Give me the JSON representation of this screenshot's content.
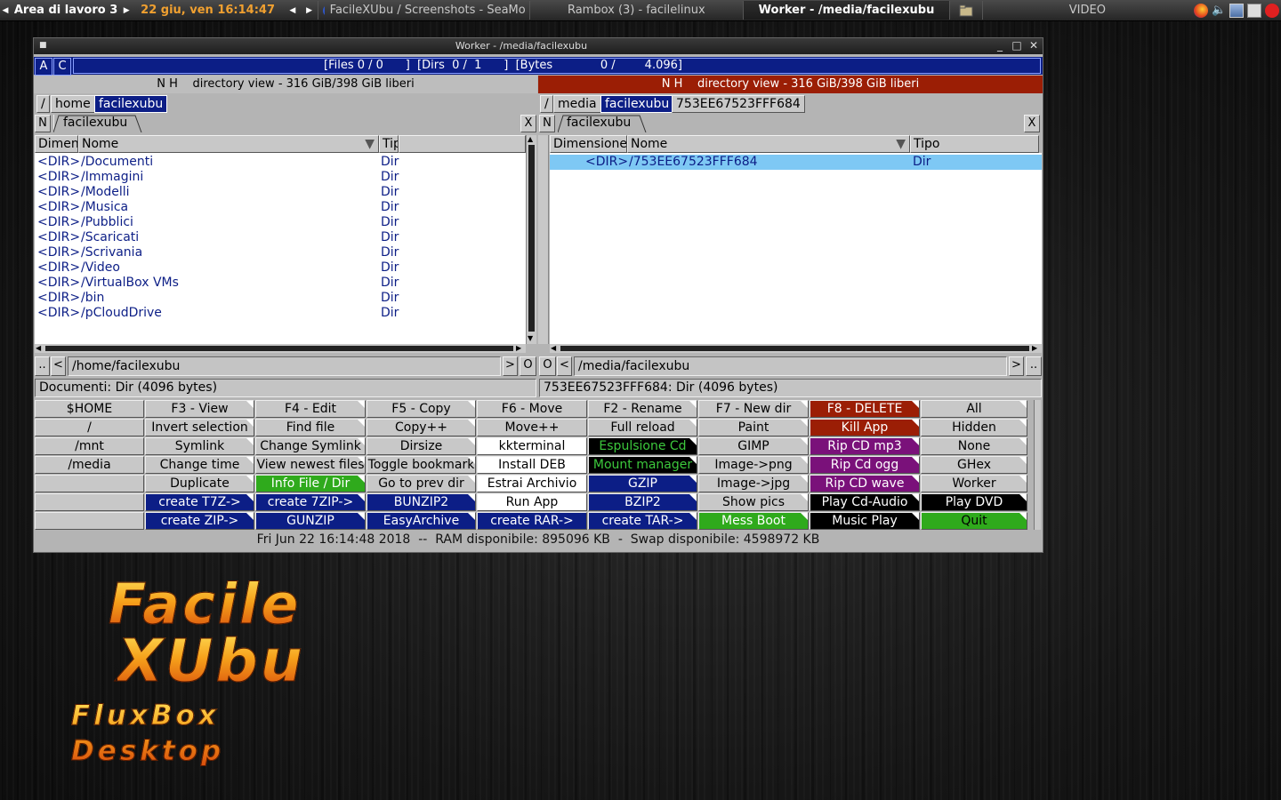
{
  "taskbar": {
    "workspace": "Area di lavoro 3",
    "datetime": "22 giu, ven 16:14:47",
    "tasks": [
      {
        "label": "FacileXUbu / Screenshots - SeaMo",
        "active": false
      },
      {
        "label": "Rambox (3) - facilelinux",
        "active": false
      },
      {
        "label": "Worker - /media/facilexubu",
        "active": true
      },
      {
        "label": "",
        "active": false
      },
      {
        "label": "VIDEO",
        "active": false
      }
    ]
  },
  "window": {
    "title": "Worker - /media/facilexubu",
    "status_a": "A",
    "status_c": "C",
    "status_text": "[Files 0 / 0      ]  [Dirs  0 /  1      ]  [Bytes             0 /        4.096]",
    "left": {
      "header": "N H    directory view - 316 GiB/398 GiB liberi",
      "crumbs": [
        "/",
        "home",
        "facilexubu"
      ],
      "tab_new": "N",
      "tab_label": "facilexubu",
      "tab_close": "X",
      "columns": [
        "Dimen",
        "Nome",
        "Tip"
      ],
      "rows": [
        {
          "size": "<DIR>",
          "name": "/Documenti",
          "type": "Dir"
        },
        {
          "size": "<DIR>",
          "name": "/Immagini",
          "type": "Dir"
        },
        {
          "size": "<DIR>",
          "name": "/Modelli",
          "type": "Dir"
        },
        {
          "size": "<DIR>",
          "name": "/Musica",
          "type": "Dir"
        },
        {
          "size": "<DIR>",
          "name": "/Pubblici",
          "type": "Dir"
        },
        {
          "size": "<DIR>",
          "name": "/Scaricati",
          "type": "Dir"
        },
        {
          "size": "<DIR>",
          "name": "/Scrivania",
          "type": "Dir"
        },
        {
          "size": "<DIR>",
          "name": "/Video",
          "type": "Dir"
        },
        {
          "size": "<DIR>",
          "name": "/VirtualBox VMs",
          "type": "Dir"
        },
        {
          "size": "<DIR>",
          "name": "/bin",
          "type": "Dir"
        },
        {
          "size": "<DIR>",
          "name": "/pCloudDrive",
          "type": "Dir"
        }
      ],
      "path": "/home/facilexubu",
      "info": "Documenti: Dir (4096 bytes)"
    },
    "right": {
      "header": "N H    directory view - 316 GiB/398 GiB liberi",
      "crumbs": [
        "/",
        "media",
        "facilexubu",
        "753EE67523FFF684"
      ],
      "tab_new": "N",
      "tab_label": "facilexubu",
      "tab_close": "X",
      "columns": [
        "Dimensione",
        "Nome",
        "Tipo"
      ],
      "rows": [
        {
          "size": "<DIR>",
          "name": "/753EE67523FFF684",
          "type": "Dir"
        }
      ],
      "path": "/media/facilexubu",
      "info": "753EE67523FFF684: Dir (4096 bytes)"
    },
    "nav": {
      "parent": "..",
      "back": "<",
      "fwd": ">",
      "other": "O"
    },
    "buttons": [
      [
        "$HOME",
        "F3 - View",
        "F4 - Edit",
        "F5 - Copy",
        "F6 - Move",
        "F2 - Rename",
        "F7 - New dir",
        "F8 - DELETE",
        "All"
      ],
      [
        "/",
        "Invert selection",
        "Find file",
        "Copy++",
        "Move++",
        "Full reload",
        "Paint",
        "Kill App",
        "Hidden"
      ],
      [
        "/mnt",
        "Symlink",
        "Change Symlink",
        "Dirsize",
        "kkterminal",
        "Espulsione Cd",
        "GIMP",
        "Rip CD mp3",
        "None"
      ],
      [
        "/media",
        "Change time",
        "View newest files",
        "Toggle bookmark",
        "Install DEB",
        "Mount manager",
        "Image->png",
        "Rip Cd ogg",
        "GHex"
      ],
      [
        "",
        "Duplicate",
        "Info File / Dir",
        "Go to prev dir",
        "Estrai Archivio",
        "GZIP",
        "Image->jpg",
        "Rip CD wave",
        "Worker"
      ],
      [
        "",
        "create T7Z->",
        "create 7ZIP->",
        "BUNZIP2",
        "Run App",
        "BZIP2",
        "Show pics",
        "Play  Cd-Audio",
        "Play DVD"
      ],
      [
        "",
        "create ZIP->",
        "GUNZIP",
        "EasyArchive",
        "create RAR->",
        "create TAR->",
        "Mess Boot",
        "Music Play",
        "Quit"
      ]
    ],
    "clock_line": "Fri Jun 22 16:14:48 2018  --  RAM disponibile: 895096 KB  -  Swap disponibile: 4598972 KB"
  },
  "logo": {
    "line1": "Facile",
    "line2": "XUbu",
    "line3": "FluxBox Desktop"
  },
  "colors": {
    "navy": "#0c1e86",
    "red": "#9b1e05",
    "green": "#2faa1c",
    "purple": "#7a117a",
    "selection": "#7ec8f4"
  }
}
